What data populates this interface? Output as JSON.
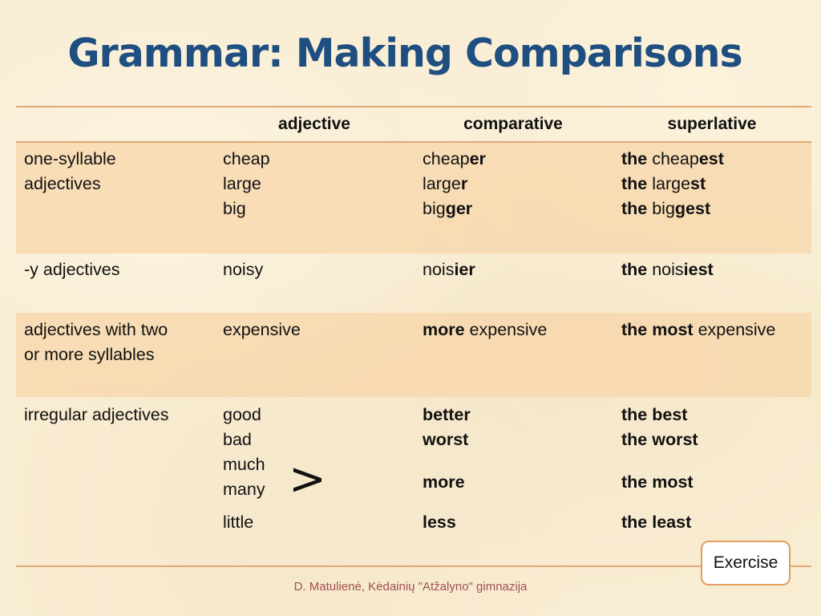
{
  "title": "Grammar: Making Comparisons",
  "table": {
    "headers": [
      "",
      "adjective",
      "comparative",
      "superlative"
    ],
    "rows": [
      {
        "category": [
          "one-syllable",
          "adjectives"
        ],
        "adjective": [
          "cheap",
          "large",
          "big"
        ],
        "comparative": [
          [
            {
              "t": "cheap",
              "b": false
            },
            {
              "t": "er",
              "b": true
            }
          ],
          [
            {
              "t": "large",
              "b": false
            },
            {
              "t": "r",
              "b": true
            }
          ],
          [
            {
              "t": "big",
              "b": false
            },
            {
              "t": "ger",
              "b": true
            }
          ]
        ],
        "superlative": [
          [
            {
              "t": "the",
              "b": true
            },
            {
              "t": " cheap",
              "b": false
            },
            {
              "t": "est",
              "b": true
            }
          ],
          [
            {
              "t": "the",
              "b": true
            },
            {
              "t": " large",
              "b": false
            },
            {
              "t": "st",
              "b": true
            }
          ],
          [
            {
              "t": "the",
              "b": true
            },
            {
              "t": " big",
              "b": false
            },
            {
              "t": "gest",
              "b": true
            }
          ]
        ]
      },
      {
        "category": [
          "-y adjectives"
        ],
        "adjective": [
          "noisy"
        ],
        "comparative": [
          [
            {
              "t": "nois",
              "b": false
            },
            {
              "t": "ier",
              "b": true
            }
          ]
        ],
        "superlative": [
          [
            {
              "t": "the",
              "b": true
            },
            {
              "t": " nois",
              "b": false
            },
            {
              "t": "iest",
              "b": true
            }
          ]
        ]
      },
      {
        "category": [
          "adjectives with two",
          "or more syllables"
        ],
        "adjective": [
          "expensive"
        ],
        "comparative": [
          [
            {
              "t": "more",
              "b": true
            },
            {
              "t": " expensive",
              "b": false
            }
          ]
        ],
        "superlative": [
          [
            {
              "t": "the most",
              "b": true
            },
            {
              "t": " expensive",
              "b": false
            }
          ]
        ]
      },
      {
        "category": [
          "irregular adjectives"
        ],
        "adjective": [
          "good",
          "bad",
          "much",
          "many",
          "little"
        ],
        "comparative": [
          [
            {
              "t": "better",
              "b": true
            }
          ],
          [
            {
              "t": "worst",
              "b": true
            }
          ],
          [
            {
              "t": "more",
              "b": true
            }
          ],
          [
            {
              "t": "less",
              "b": true
            }
          ]
        ],
        "superlative": [
          [
            {
              "t": "the best",
              "b": true
            }
          ],
          [
            {
              "t": "the worst",
              "b": true
            }
          ],
          [
            {
              "t": "the most",
              "b": true
            }
          ],
          [
            {
              "t": "the least",
              "b": true
            }
          ]
        ],
        "merge_symbol": ">"
      }
    ]
  },
  "exercise_button": "Exercise",
  "footer": "D. Matulienė, Kėdainių \"Atžalyno\" gimnazija",
  "colors": {
    "title": "#1f4e80",
    "rule": "#e3a978",
    "band": "#f7d6aa",
    "footer": "#a15050",
    "button_border": "#e0a060"
  }
}
